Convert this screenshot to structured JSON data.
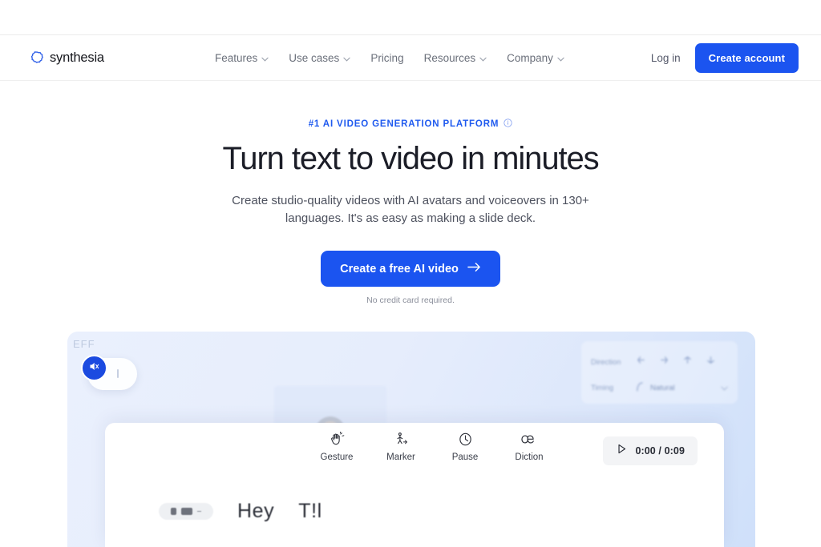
{
  "header": {
    "brand": {
      "name": "synthesia",
      "logo_icon": "synthesia-gear-logo",
      "color": "#1b54f0"
    },
    "nav_items": [
      {
        "label": "Features",
        "has_dropdown": true
      },
      {
        "label": "Use cases",
        "has_dropdown": true
      },
      {
        "label": "Pricing",
        "has_dropdown": false
      },
      {
        "label": "Resources",
        "has_dropdown": true
      },
      {
        "label": "Company",
        "has_dropdown": true
      }
    ],
    "login_label": "Log in",
    "create_account_label": "Create account"
  },
  "hero": {
    "eyebrow": "#1 AI VIDEO GENERATION PLATFORM",
    "eyebrow_icon": "info-circle-icon",
    "eyebrow_color": "#1f5aef",
    "title": "Turn text to video in minutes",
    "subtitle": "Create studio-quality videos with AI avatars and voiceovers in 130+ languages. It's as easy as making a slide deck.",
    "cta_label": "Create a free AI video",
    "cta_icon": "arrow-right-icon",
    "cta_color": "#1b54f0",
    "footnote": "No credit card required."
  },
  "preview": {
    "effects_label": "EFF",
    "mute_icon": "speaker-muted-icon",
    "avatar_alt": "ai-avatar-presenter",
    "side_panel": {
      "direction_label": "Direction",
      "direction_icons": [
        "arrow-left-icon",
        "arrow-right-icon",
        "arrow-up-icon",
        "arrow-down-icon"
      ],
      "timing_label": "Timing",
      "timing_value": "Natural",
      "timing_icon": "curve-icon",
      "timing_caret": "chevron-down-icon"
    }
  },
  "editor": {
    "tools": [
      {
        "label": "Gesture",
        "icon": "hand-gesture-icon"
      },
      {
        "label": "Marker",
        "icon": "marker-person-icon"
      },
      {
        "label": "Pause",
        "icon": "clock-icon"
      },
      {
        "label": "Diction",
        "icon": "ae-ligature-icon"
      }
    ],
    "player": {
      "play_icon": "play-triangle-icon",
      "time": "0:00 / 0:09"
    },
    "script": {
      "chip_icon": "avatar-chip-icon",
      "word_1": "Hey",
      "word_2": "T!l"
    }
  }
}
